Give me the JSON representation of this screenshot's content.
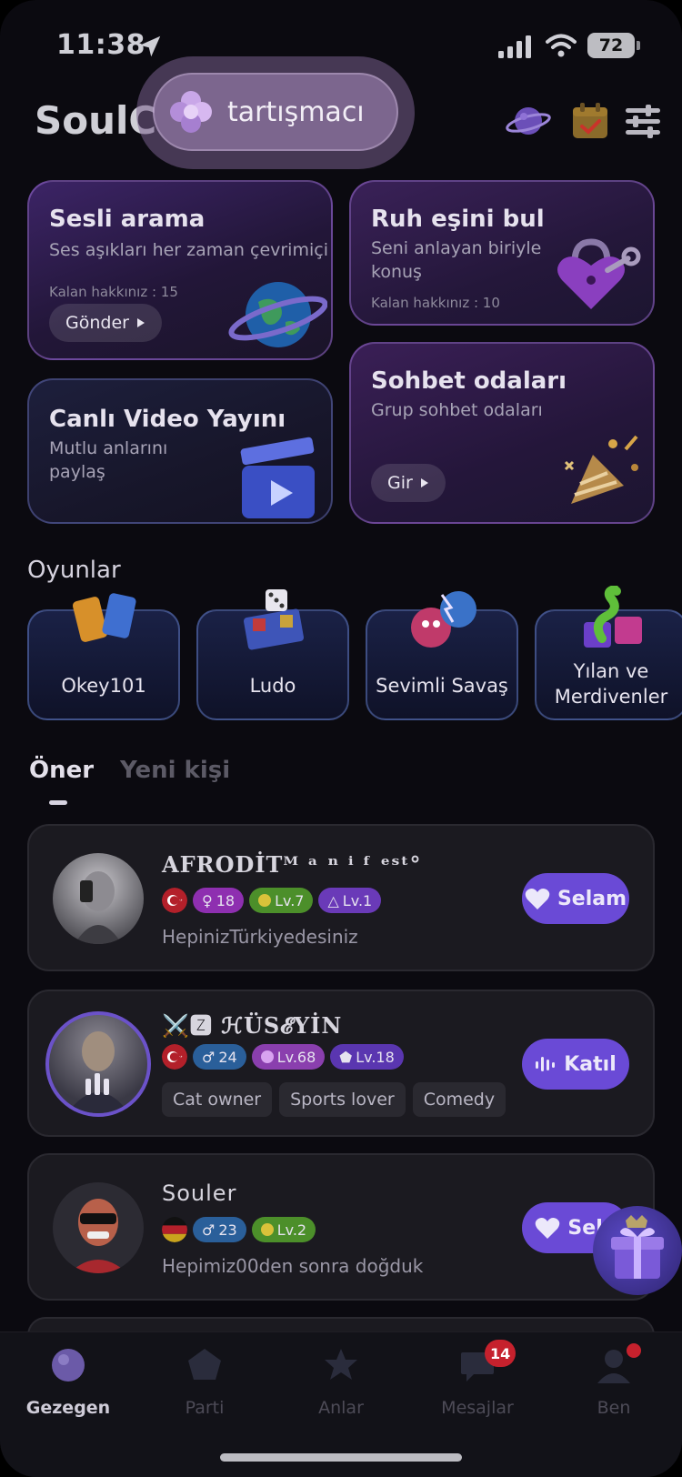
{
  "status_bar": {
    "time": "11:38",
    "battery": "72"
  },
  "header": {
    "app_title": "SoulC",
    "tooltip_text": "tartışmacı"
  },
  "feature_cards": [
    {
      "title": "Sesli arama",
      "subtitle": "Ses aşıkları her zaman çevrimiçi",
      "remaining": "Kalan hakkınız : 15",
      "button": "Gönder"
    },
    {
      "title": "Ruh eşini bul",
      "subtitle_line1": "Seni anlayan biriyle",
      "subtitle_line2": "konuş",
      "remaining": "Kalan hakkınız : 10"
    },
    {
      "title": "Canlı Video Yayını",
      "subtitle_line1": "Mutlu anlarını",
      "subtitle_line2": "paylaş"
    },
    {
      "title": "Sohbet odaları",
      "subtitle": "Grup sohbet odaları",
      "button": "Gir"
    }
  ],
  "games": {
    "title": "Oyunlar",
    "items": [
      {
        "label": "Okey101"
      },
      {
        "label": "Ludo"
      },
      {
        "label": "Sevimli Savaş"
      },
      {
        "label_line1": "Yılan ve",
        "label_line2": "Merdivenler"
      }
    ]
  },
  "tabs": [
    {
      "label": "Öner"
    },
    {
      "label": "Yeni kişi"
    }
  ],
  "users": [
    {
      "name": "AFRODİTᴹ ᵃ ⁿ ⁱ ᶠ ᵉˢᵗ°",
      "badges": {
        "gender_age": "18",
        "level1": "Lv.7",
        "level2": "Lv.1"
      },
      "bio": "HepinizTürkiyedesiniz",
      "action": "Selam"
    },
    {
      "name": "⚔️🆉 ℋÜS𝓔YİN",
      "badges": {
        "gender_age": "24",
        "level1": "Lv.68",
        "level2": "Lv.18"
      },
      "tags": [
        "Cat owner",
        "Sports lover",
        "Comedy"
      ],
      "action": "Katıl"
    },
    {
      "name": "Souler",
      "badges": {
        "gender_age": "23",
        "level1": "Lv.2"
      },
      "bio": "Hepimiz00den sonra doğduk",
      "action": "Sela"
    }
  ],
  "bottom_nav": [
    {
      "label": "Gezegen",
      "active": true
    },
    {
      "label": "Parti"
    },
    {
      "label": "Anlar"
    },
    {
      "label": "Mesajlar",
      "badge": "14"
    },
    {
      "label": "Ben"
    }
  ],
  "colors": {
    "accent_purple": "#6a4ad6",
    "badge_red": "#c6212d",
    "background": "#0b0a10"
  }
}
